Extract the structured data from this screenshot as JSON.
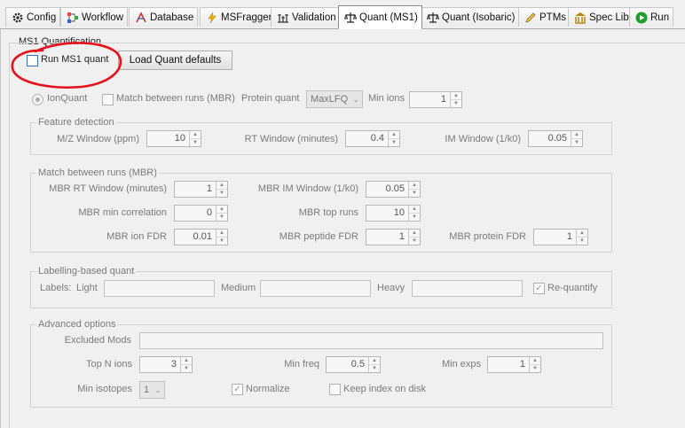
{
  "tabs": [
    {
      "label": "Config",
      "icon": "gear-icon"
    },
    {
      "label": "Workflow",
      "icon": "workflow-icon"
    },
    {
      "label": "Database",
      "icon": "database-icon"
    },
    {
      "label": "MSFragger",
      "icon": "lightning-icon"
    },
    {
      "label": "Validation",
      "icon": "validation-icon"
    },
    {
      "label": "Quant (MS1)",
      "icon": "scale-icon"
    },
    {
      "label": "Quant (Isobaric)",
      "icon": "scale-icon"
    },
    {
      "label": "PTMs",
      "icon": "pencil-icon"
    },
    {
      "label": "Spec Lib",
      "icon": "library-icon"
    },
    {
      "label": "Run",
      "icon": "play-icon"
    }
  ],
  "active_tab": "Quant (MS1)",
  "section_title": "MS1 Quantification",
  "run_ms1_quant": {
    "label": "Run MS1 quant",
    "checked": false
  },
  "load_defaults_button": "Load Quant defaults",
  "ionquant": {
    "label": "IonQuant",
    "selected": true
  },
  "match_between_runs": {
    "label": "Match between runs (MBR)",
    "checked": false
  },
  "protein_quant": {
    "label": "Protein quant",
    "value": "MaxLFQ"
  },
  "min_ions": {
    "label": "Min ions",
    "value": "1"
  },
  "feature_detection": {
    "title": "Feature detection",
    "mz_window": {
      "label": "M/Z Window (ppm)",
      "value": "10"
    },
    "rt_window": {
      "label": "RT Window (minutes)",
      "value": "0.4"
    },
    "im_window": {
      "label": "IM Window (1/k0)",
      "value": "0.05"
    }
  },
  "mbr": {
    "title": "Match between runs (MBR)",
    "rt_window": {
      "label": "MBR RT Window (minutes)",
      "value": "1"
    },
    "im_window": {
      "label": "MBR IM Window (1/k0)",
      "value": "0.05"
    },
    "min_correlation": {
      "label": "MBR min correlation",
      "value": "0"
    },
    "top_runs": {
      "label": "MBR top runs",
      "value": "10"
    },
    "ion_fdr": {
      "label": "MBR ion FDR",
      "value": "0.01"
    },
    "peptide_fdr": {
      "label": "MBR peptide FDR",
      "value": "1"
    },
    "protein_fdr": {
      "label": "MBR protein FDR",
      "value": "1"
    }
  },
  "labelling": {
    "title": "Labelling-based quant",
    "labels_label": "Labels:",
    "light": {
      "label": "Light",
      "value": ""
    },
    "medium": {
      "label": "Medium",
      "value": ""
    },
    "heavy": {
      "label": "Heavy",
      "value": ""
    },
    "requantify": {
      "label": "Re-quantify",
      "checked": true
    }
  },
  "advanced": {
    "title": "Advanced options",
    "excluded_mods": {
      "label": "Excluded Mods",
      "value": ""
    },
    "top_n_ions": {
      "label": "Top N ions",
      "value": "3"
    },
    "min_freq": {
      "label": "Min freq",
      "value": "0.5"
    },
    "min_exps": {
      "label": "Min exps",
      "value": "1"
    },
    "min_isotopes": {
      "label": "Min isotopes",
      "value": "1"
    },
    "normalize": {
      "label": "Normalize",
      "checked": true
    },
    "keep_index": {
      "label": "Keep index on disk",
      "checked": false
    }
  },
  "colors": {
    "annotation_red": "#e8101a",
    "checkbox_border": "#3c6fb3",
    "disabled_text": "#7a7a7a"
  }
}
